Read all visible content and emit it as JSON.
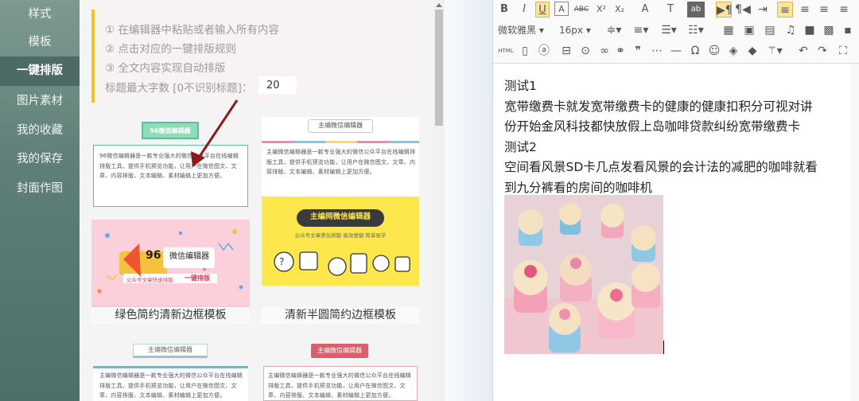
{
  "sidebar": {
    "items": [
      {
        "label": "样式"
      },
      {
        "label": "模板"
      },
      {
        "label": "一键排版"
      },
      {
        "label": "图片素材"
      },
      {
        "label": "我的收藏"
      },
      {
        "label": "我的保存"
      },
      {
        "label": "封面作图"
      }
    ],
    "active_index": 2
  },
  "notice": {
    "step1": "① 在编辑器中粘贴或者输入所有内容",
    "step2": "② 点击对应的一键排版规则",
    "step3": "③ 全文内容实现自动排版",
    "maxlen_label": "标题最大字数 [0不识别标题]：",
    "maxlen_value": "20"
  },
  "templates": [
    {
      "title_tag": "96微信编辑器",
      "body_text": "96微信编辑器是一款专业强大的微信公众平台在线编辑排版工具，提供手机预览功能，让用户在微信图文、文章、内容排版、文本编辑、素材编辑上更加方便。",
      "caption": "绿色简约清新边框模板"
    },
    {
      "title_tag": "主编微信编辑器",
      "body_text": "主编微信编辑器是一款专业强大的微信公众平台在线编辑排版工具，提供手机预览功能，让用户在微信图文、文章、内容排版、文本编辑、素材编辑上更加方便。",
      "caption": "清新半圆简约边框模板"
    },
    {
      "title_tag": "主编微信编辑器",
      "body_text": "主编微信编辑器是一款专业强大的微信公众平台在线编辑排版工具，提供手机预览功能，让用户在微信图文、文章、内容排版、文本编辑、素材编辑上更加方便。"
    },
    {
      "title_tag": "主编微信编辑器",
      "body_text": "主编微信编辑器是一款专业强大的微信公众平台在线编辑排版工具，提供手机预览功能，让用户在微信图文、文章、内容排版、文本编辑、素材编辑上更加方便。"
    }
  ],
  "banners": {
    "pink": {
      "badge": "96",
      "title": "微信编辑器",
      "subtitle": "公众号文章快速排版",
      "cta": "一键排版"
    },
    "yellow": {
      "title": "主编网微信编辑器",
      "subtitle": "公众号文章美化排版·高效便捷·简单易学"
    }
  },
  "toolbar": {
    "font_family": "微软雅黑",
    "font_size": "16px",
    "row1": [
      "B",
      "I",
      "U",
      "A",
      "ABC",
      "X²",
      "X₂",
      "A",
      "T",
      "ab"
    ],
    "html_label": "HTML"
  },
  "editor": {
    "lines": [
      "测试1",
      "宽带缴费卡就发宽带缴费卡的健康的健康扣积分可视对讲",
      "份开始金风科技都快放假上岛咖啡贷款纠纷宽带缴费卡",
      "测试2",
      "空间看风景SD卡几点发看风景的会计法的减肥的咖啡就看",
      "到九分裤看的房间的咖啡机"
    ]
  },
  "colors": {
    "sidebar_bg": "#5f7f78",
    "notice_accent": "#f2c12e",
    "green_border": "#5bbf9f",
    "arrow": "#8b1a1a"
  }
}
